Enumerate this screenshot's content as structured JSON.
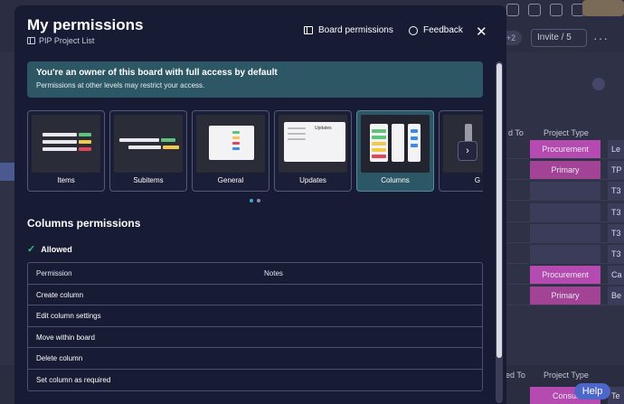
{
  "background": {
    "invite_label": "Invite / 5",
    "plus_badge": "+2",
    "more_label": "···",
    "col_header_owner": "d To",
    "col_header_project_type": "Project Type",
    "col_header_bottom_owner": "ned To",
    "col_header_bottom_project_type": "Project Type",
    "rows": [
      {
        "type": "Procurement",
        "color": "#b54ab0",
        "side": "Le"
      },
      {
        "type": "Primary",
        "color": "#a24396",
        "side": "TP"
      },
      {
        "type": "",
        "color": "#3a3c5a",
        "side": "T3"
      },
      {
        "type": "",
        "color": "#3a3c5a",
        "side": "T3"
      },
      {
        "type": "",
        "color": "#3a3c5a",
        "side": "T3"
      },
      {
        "type": "",
        "color": "#3a3c5a",
        "side": "T3"
      },
      {
        "type": "Procurement",
        "color": "#b54ab0",
        "side": "Ca"
      },
      {
        "type": "Primary",
        "color": "#a24396",
        "side": "Be"
      }
    ],
    "bottom_cell": "Consul",
    "bottom_side": "Te",
    "help_label": "Help"
  },
  "modal": {
    "title": "My permissions",
    "subtitle": "PIP Project List",
    "board_permissions_label": "Board permissions",
    "feedback_label": "Feedback",
    "close_label": "✕",
    "banner": {
      "title": "You're an owner of this board with full access by default",
      "text": "Permissions at other levels may restrict your access."
    },
    "cards": [
      {
        "label": "Items",
        "selected": false
      },
      {
        "label": "Subitems",
        "selected": false
      },
      {
        "label": "General",
        "selected": false
      },
      {
        "label": "Updates",
        "selected": false
      },
      {
        "label": "Columns",
        "selected": true
      },
      {
        "label": "G",
        "selected": false
      }
    ],
    "updates_preview_label": "Updates",
    "next_label": "›",
    "section_title": "Columns permissions",
    "allowed_label": "Allowed",
    "table": {
      "headers": [
        "Permission",
        "Notes"
      ],
      "rows": [
        {
          "permission": "Create column",
          "notes": ""
        },
        {
          "permission": "Edit column settings",
          "notes": ""
        },
        {
          "permission": "Move within board",
          "notes": ""
        },
        {
          "permission": "Delete column",
          "notes": ""
        },
        {
          "permission": "Set column as required",
          "notes": ""
        }
      ]
    }
  },
  "colors": {
    "modal_bg": "#181b34",
    "banner_bg": "#2e5765",
    "selected_card": "#2c5766",
    "allowed_check": "#33c37a",
    "procurement": "#b54ab0",
    "primary": "#a24396",
    "help": "#4d66c9"
  }
}
